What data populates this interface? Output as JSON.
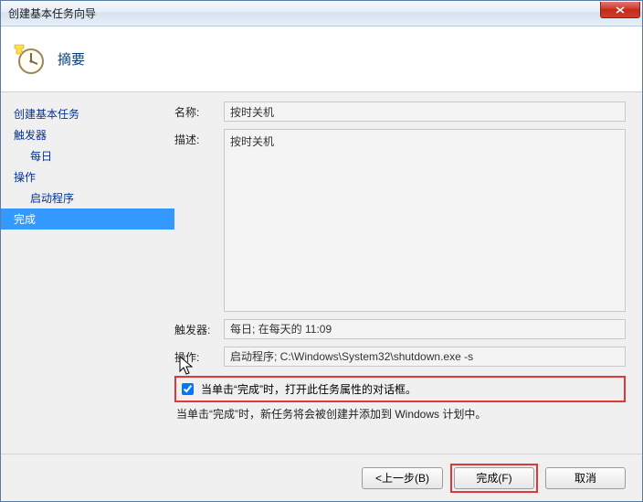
{
  "window": {
    "title": "创建基本任务向导"
  },
  "header": {
    "heading": "摘要",
    "icon": "clock-new-icon"
  },
  "sidebar": {
    "items": [
      {
        "label": "创建基本任务",
        "level": 0,
        "selected": false
      },
      {
        "label": "触发器",
        "level": 0,
        "selected": false
      },
      {
        "label": "每日",
        "level": 1,
        "selected": false
      },
      {
        "label": "操作",
        "level": 0,
        "selected": false
      },
      {
        "label": "启动程序",
        "level": 1,
        "selected": false
      },
      {
        "label": "完成",
        "level": 0,
        "selected": true
      }
    ]
  },
  "form": {
    "name_label": "名称:",
    "name_value": "按时关机",
    "desc_label": "描述:",
    "desc_value": "按时关机",
    "trigger_label": "触发器:",
    "trigger_value": "每日; 在每天的 11:09",
    "action_label": "操作:",
    "action_value": "启动程序; C:\\Windows\\System32\\shutdown.exe -s",
    "checkbox_label": "当单击“完成”时，打开此任务属性的对话框。",
    "checkbox_checked": true,
    "hint": "当单击“完成”时，新任务将会被创建并添加到 Windows 计划中。"
  },
  "buttons": {
    "back": "<上一步(B)",
    "finish": "完成(F)",
    "cancel": "取消"
  }
}
